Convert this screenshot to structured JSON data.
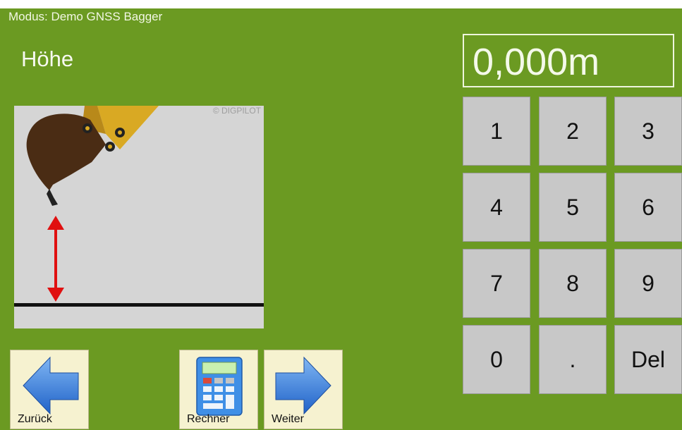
{
  "header": {
    "mode": "Modus: Demo GNSS Bagger",
    "title": "Höhe"
  },
  "illustration": {
    "copyright": "© DIGPILOT"
  },
  "display": {
    "value": "0,000m"
  },
  "keypad": {
    "keys": [
      "1",
      "2",
      "3",
      "4",
      "5",
      "6",
      "7",
      "8",
      "9",
      "0",
      ".",
      "Del"
    ]
  },
  "nav": {
    "back": "Zurück",
    "calculator": "Rechner",
    "next": "Weiter"
  },
  "colors": {
    "background": "#6b9a22",
    "key": "#c8c8c8",
    "nav_button": "#f6f2d0",
    "arrow": "#2f7ad8",
    "measure_arrow": "#e01010"
  }
}
